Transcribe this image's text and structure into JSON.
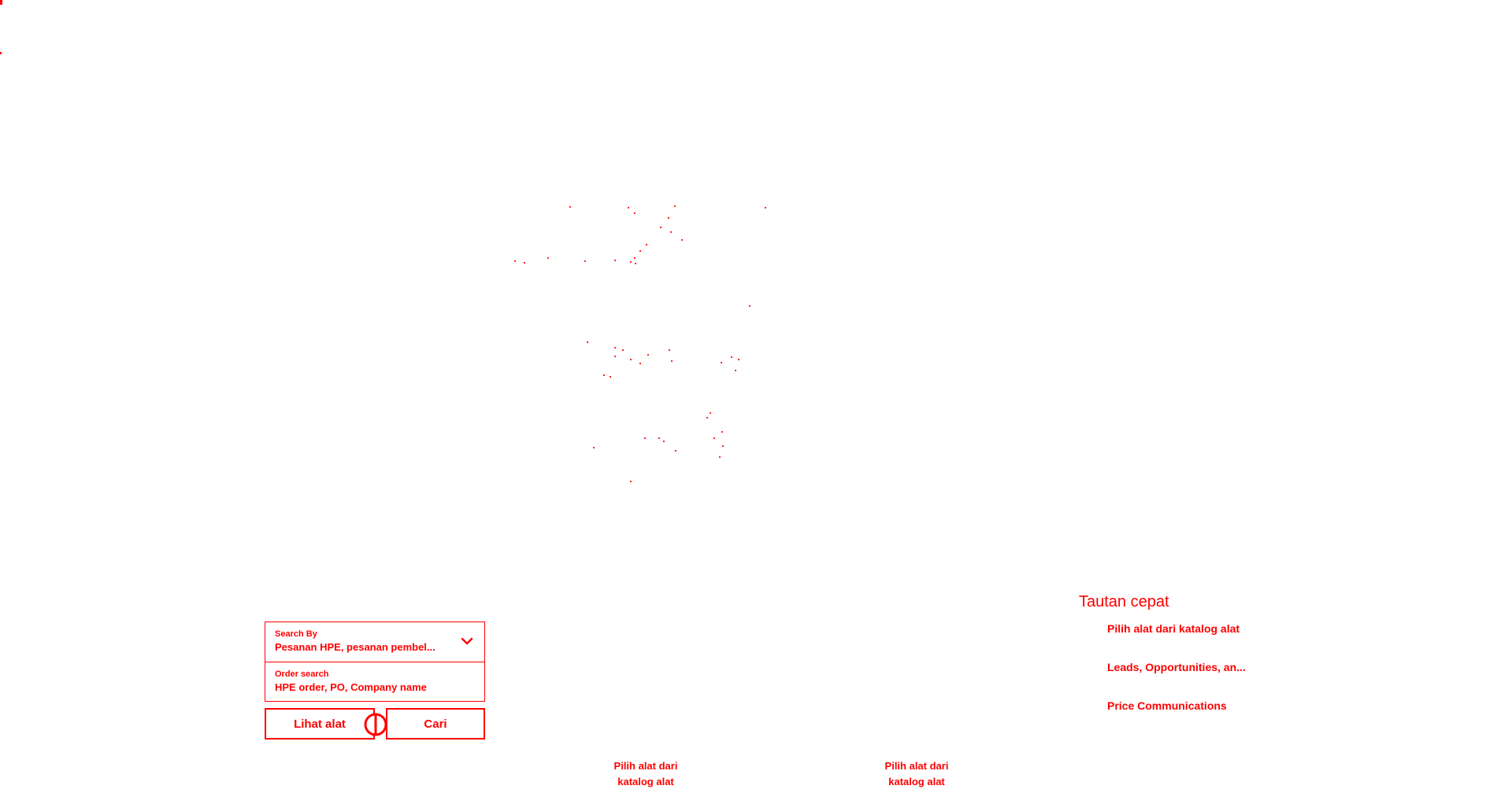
{
  "search": {
    "search_by_label": "Search By",
    "search_by_value": "Pesanan HPE, pesanan pembel...",
    "order_search_label": "Order search",
    "order_search_placeholder": "HPE order, PO, Company name",
    "view_tools_button": "Lihat alat",
    "search_button": "Cari",
    "dropdown_icon": "chevron-down-icon",
    "cursor_icon": "loading-cursor-icon"
  },
  "quick_links": {
    "title": "Tautan cepat",
    "items": [
      {
        "label": "Pilih alat dari katalog alat"
      },
      {
        "label": "Leads, Opportunities, an..."
      },
      {
        "label": "Price Communications"
      }
    ]
  },
  "catalog_tiles": [
    {
      "line1": "Pilih alat dari",
      "line2": "katalog alat"
    },
    {
      "line1": "Pilih alat dari",
      "line2": "katalog alat"
    }
  ],
  "colors": {
    "accent": "#ff0000",
    "background": "#ffffff"
  }
}
